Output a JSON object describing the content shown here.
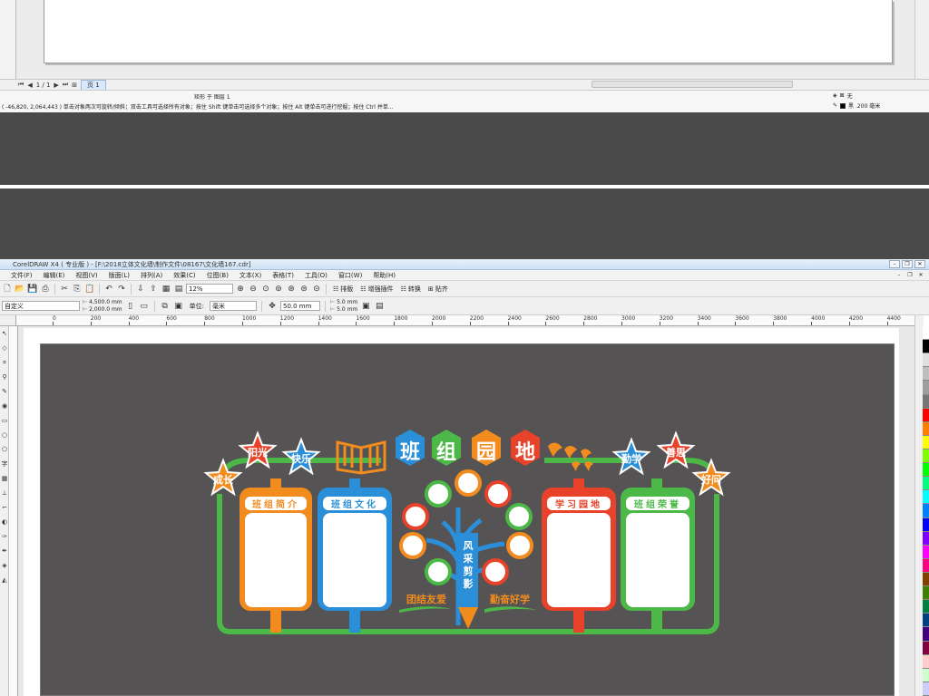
{
  "prev_window": {
    "page_count": "1 / 1",
    "page_tab": "页 1",
    "status_line1": "矩形 于 图层 1",
    "status_line2": "( -46,820, 2,064,443 )  单击对象两次可旋转/倾斜；双击工具可选择所有对象；按住 Shift 键单击可选择多个对象；按住 Alt 键单击可进行挖掘；按住 Ctrl 并单...",
    "fill_label": "无",
    "stroke_label": "黑  .200 毫米"
  },
  "app": {
    "title": "CorelDRAW X4 ( 专业版 ) - [F:\\2018立体文化墙\\制作文件\\08167\\文化墙167.cdr]",
    "accent": "#3aa85a"
  },
  "menu": [
    "文件(F)",
    "编辑(E)",
    "视图(V)",
    "版面(L)",
    "排列(A)",
    "效果(C)",
    "位图(B)",
    "文本(X)",
    "表格(T)",
    "工具(O)",
    "窗口(W)",
    "帮助(H)"
  ],
  "toolbar1": {
    "zoom": "12%",
    "btn_arrange": "排版",
    "btn_plugin": "增强插件",
    "btn_convert": "转换",
    "btn_paste": "贴齐"
  },
  "toolbar2": {
    "preset": "自定义",
    "width": "4,500.0 mm",
    "height": "2,000.0 mm",
    "unit_label": "单位:",
    "unit": "毫米",
    "nudge": "50.0 mm",
    "dup_x": "5.0 mm",
    "dup_y": "5.0 mm"
  },
  "ruler_ticks": [
    "0",
    "200",
    "400",
    "600",
    "800",
    "1000",
    "1200",
    "1400",
    "1600",
    "1800",
    "2000",
    "2200",
    "2400",
    "2600",
    "2800",
    "3000",
    "3200",
    "3400",
    "3600",
    "3800",
    "4000",
    "4200",
    "4400"
  ],
  "design": {
    "title_chars": [
      "班",
      "组",
      "园",
      "地"
    ],
    "title_colors": [
      "#2a8fd8",
      "#4cb848",
      "#f28c1e",
      "#e8422a"
    ],
    "stars_left": [
      {
        "label": "成长",
        "color": "#f28c1e"
      },
      {
        "label": "阳光",
        "color": "#e8422a"
      },
      {
        "label": "快乐",
        "color": "#2a8fd8"
      }
    ],
    "stars_right": [
      {
        "label": "勤学",
        "color": "#2a8fd8"
      },
      {
        "label": "善思",
        "color": "#e8422a"
      },
      {
        "label": "好问",
        "color": "#f28c1e"
      }
    ],
    "panels": [
      {
        "title": "班组简介",
        "color": "#f28c1e"
      },
      {
        "title": "班组文化",
        "color": "#2a8fd8"
      },
      {
        "title": "学习园地",
        "color": "#e8422a"
      },
      {
        "title": "班组荣誉",
        "color": "#4cb848"
      }
    ],
    "tree_label": "风采剪影",
    "slogan_left": "团结友爱",
    "slogan_right": "勤奋好学",
    "frame_color": "#4cb848",
    "wall_color": "#555354"
  }
}
